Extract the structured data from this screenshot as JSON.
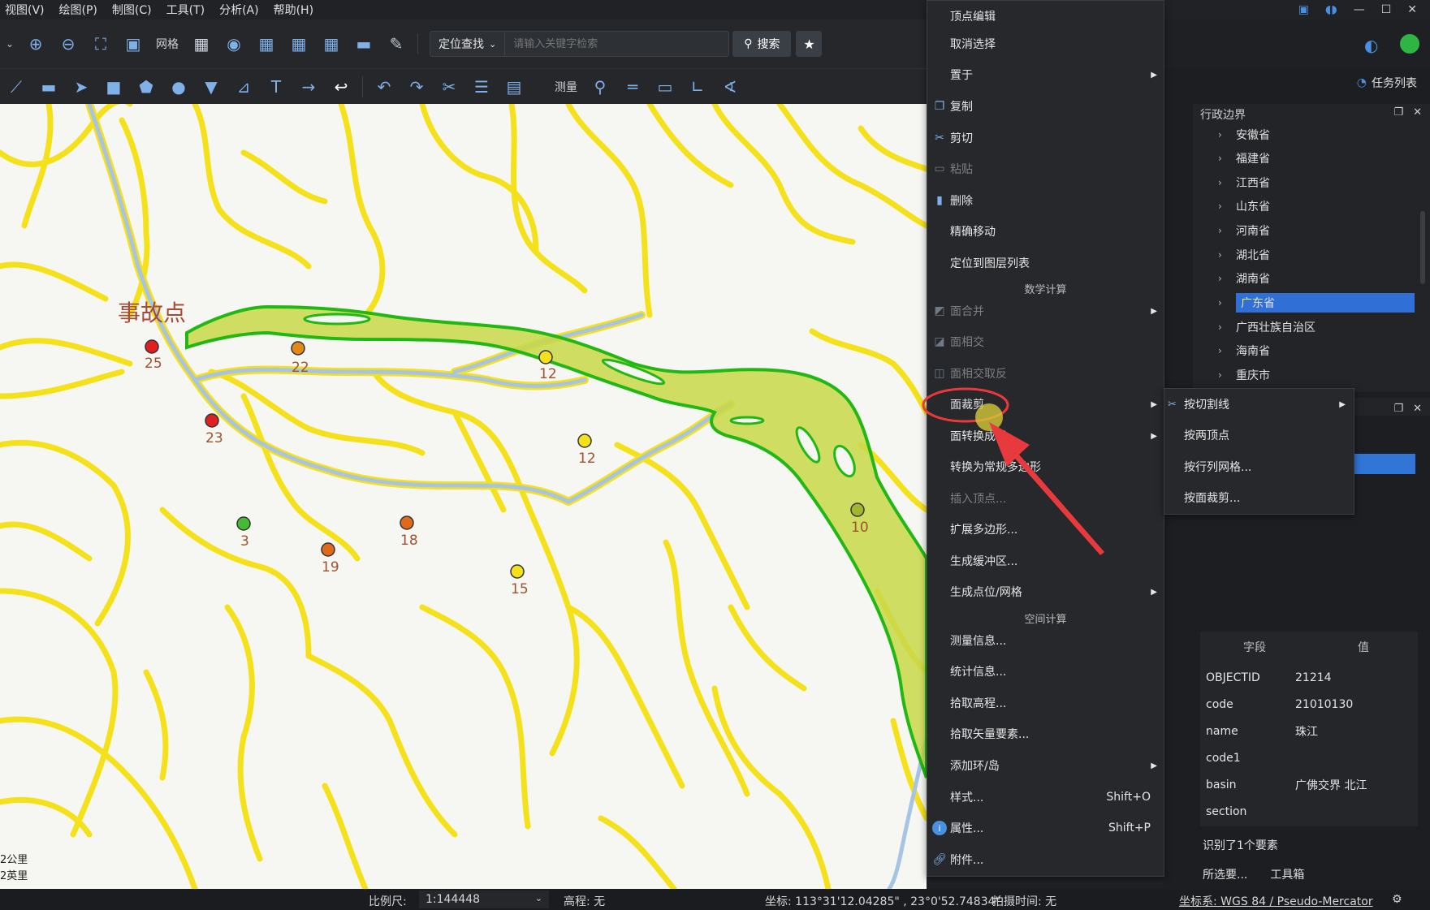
{
  "menubar": {
    "items": [
      {
        "label": "视图(V)"
      },
      {
        "label": "绘图(P)"
      },
      {
        "label": "制图(C)"
      },
      {
        "label": "工具(T)"
      },
      {
        "label": "分析(A)"
      },
      {
        "label": "帮助(H)"
      }
    ]
  },
  "toolbar1": {
    "grid_label": "网格",
    "locate_dropdown": "定位查找",
    "search_placeholder": "请输入关键字检索",
    "search_button": "搜索"
  },
  "toolbar2": {
    "measure_label": "测量"
  },
  "right_header": {
    "task_list": "任务列表"
  },
  "layer_tree": {
    "title": "行政边界",
    "items": [
      {
        "label": "安徽省"
      },
      {
        "label": "福建省"
      },
      {
        "label": "江西省"
      },
      {
        "label": "山东省"
      },
      {
        "label": "河南省"
      },
      {
        "label": "湖北省"
      },
      {
        "label": "湖南省"
      },
      {
        "label": "广东省",
        "selected": true
      },
      {
        "label": "广西壮族自治区"
      },
      {
        "label": "海南省"
      },
      {
        "label": "重庆市"
      }
    ]
  },
  "map": {
    "accident_label": "事故点",
    "point_labels": [
      "25",
      "22",
      "12",
      "23",
      "12",
      "3",
      "18",
      "19",
      "15",
      "10"
    ],
    "scale": [
      "2公里",
      "2英里"
    ]
  },
  "context_menu": {
    "items": [
      {
        "label": "顶点编辑",
        "icon": "none",
        "disabled": false
      },
      {
        "label": "取消选择",
        "icon": "none",
        "disabled": false
      },
      {
        "label": "置于",
        "icon": "none",
        "disabled": false,
        "submenu": true
      },
      {
        "label": "复制",
        "icon": "copy-icon",
        "disabled": false
      },
      {
        "label": "剪切",
        "icon": "scissors-icon",
        "disabled": false
      },
      {
        "label": "粘贴",
        "icon": "paste-icon",
        "disabled": true
      },
      {
        "label": "删除",
        "icon": "delete-icon",
        "disabled": false
      },
      {
        "label": "精确移动",
        "icon": "none",
        "disabled": false
      },
      {
        "label": "定位到图层列表",
        "icon": "none",
        "disabled": false
      },
      {
        "label": "面合并",
        "icon": "polygon-merge-icon",
        "disabled": true,
        "submenu": true
      },
      {
        "label": "面相交",
        "icon": "polygon-intersect-icon",
        "disabled": true
      },
      {
        "label": "面相交取反",
        "icon": "polygon-xor-icon",
        "disabled": true
      },
      {
        "label": "面裁剪",
        "icon": "none",
        "disabled": false,
        "submenu": true
      },
      {
        "label": "面转换成线",
        "icon": "none",
        "disabled": false,
        "submenu": true
      },
      {
        "label": "转换为常规多边形",
        "icon": "none",
        "disabled": false
      },
      {
        "label": "插入顶点...",
        "icon": "none",
        "disabled": true
      },
      {
        "label": "扩展多边形...",
        "icon": "none",
        "disabled": false
      },
      {
        "label": "生成缓冲区...",
        "icon": "none",
        "disabled": false
      },
      {
        "label": "生成点位/网格",
        "icon": "none",
        "disabled": false,
        "submenu": true
      },
      {
        "label": "测量信息...",
        "icon": "none",
        "disabled": false
      },
      {
        "label": "统计信息...",
        "icon": "none",
        "disabled": false
      },
      {
        "label": "拾取高程...",
        "icon": "none",
        "disabled": false
      },
      {
        "label": "拾取矢量要素...",
        "icon": "none",
        "disabled": false
      },
      {
        "label": "添加环/岛",
        "icon": "none",
        "disabled": false,
        "submenu": true
      },
      {
        "label": "样式...",
        "icon": "none",
        "disabled": false,
        "shortcut": "Shift+O"
      },
      {
        "label": "属性...",
        "icon": "info-icon",
        "disabled": false,
        "shortcut": "Shift+P"
      },
      {
        "label": "附件...",
        "icon": "link-icon",
        "disabled": false
      }
    ],
    "sections": [
      "数学计算",
      "空间计算"
    ]
  },
  "clip_submenu": {
    "items": [
      {
        "label": "按切割线",
        "submenu": true
      },
      {
        "label": "按两顶点"
      },
      {
        "label": "按行列网格..."
      },
      {
        "label": "按面裁剪..."
      }
    ]
  },
  "attributes": {
    "header_field": "字段",
    "header_value": "值",
    "rows": [
      {
        "k": "OBJECTID",
        "v": "21214"
      },
      {
        "k": "code",
        "v": "21010130"
      },
      {
        "k": "name",
        "v": "珠江"
      },
      {
        "k": "code1",
        "v": ""
      },
      {
        "k": "basin",
        "v": "广佛交界 北江"
      },
      {
        "k": "section",
        "v": ""
      }
    ],
    "identified": "识别了1个要素",
    "tab_selected": "所选要...",
    "tab_toolbox": "工具箱"
  },
  "statusbar": {
    "scale_label": "比例尺:",
    "scale_value": "1:144448",
    "elev_label": "高程:  无",
    "coords": "坐标:  113°31'12.04285\" , 23°0'52.74834\"",
    "capture_time": "拍摄时间:  无",
    "crs": "坐标系:  WGS 84 / Pseudo-Mercator"
  },
  "colors": {
    "accent": "#2f6fd6",
    "road": "#f5e11a",
    "river": "#a8c4e4",
    "selection_outline": "#22b814",
    "selection_fill": "#c8d84a",
    "annotation_red": "#e8393d"
  }
}
